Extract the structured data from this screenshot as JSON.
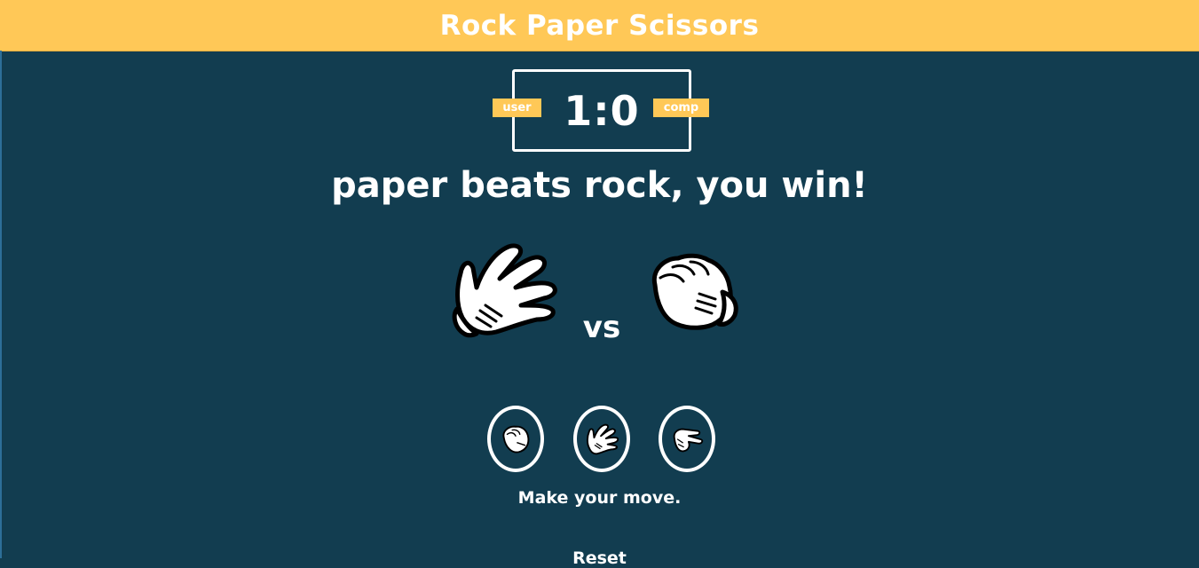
{
  "header": {
    "title": "Rock Paper Scissors"
  },
  "scoreboard": {
    "user_label": "user",
    "comp_label": "comp",
    "score": "1:0",
    "user_score": 1,
    "comp_score": 0
  },
  "result": {
    "message": "paper beats rock, you win!"
  },
  "battle": {
    "user_choice_icon": "paper-hand-icon",
    "comp_choice_icon": "rock-hand-icon",
    "vs_label": "vs"
  },
  "choices": [
    {
      "id": "rock",
      "icon": "rock-hand-icon"
    },
    {
      "id": "paper",
      "icon": "paper-hand-icon"
    },
    {
      "id": "scissors",
      "icon": "scissors-hand-icon"
    }
  ],
  "prompt": {
    "text": "Make your move."
  },
  "footer": {
    "partial_text": "Reset"
  },
  "colors": {
    "accent": "#ffc857",
    "background": "#123d50",
    "text": "#ffffff"
  }
}
